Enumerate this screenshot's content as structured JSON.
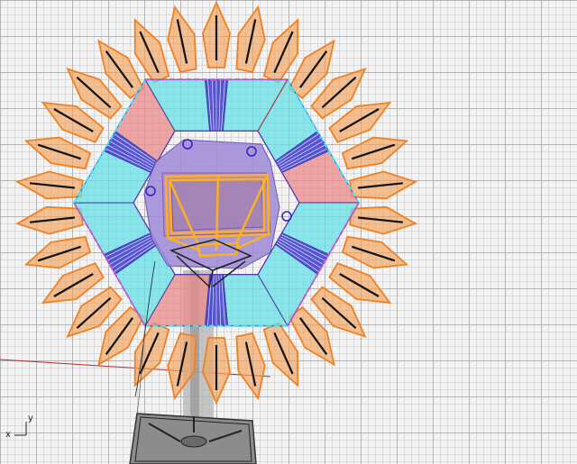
{
  "viewport": {
    "name": "perspective-viewport",
    "axis_x_label": "x",
    "axis_y_label": "y"
  },
  "model": {
    "petal_count": 30,
    "petal_fill": "#f2a35a",
    "petal_edge": "#f08020",
    "panel_cyan": "#66e0e6",
    "panel_red": "#e98a8a",
    "panel_purple": "#9a80e0",
    "frame_orange": "#ffb020",
    "stem_color": "#9a9a9a",
    "base_color": "#5a5a5a",
    "world_x_axis": "#b03030"
  }
}
